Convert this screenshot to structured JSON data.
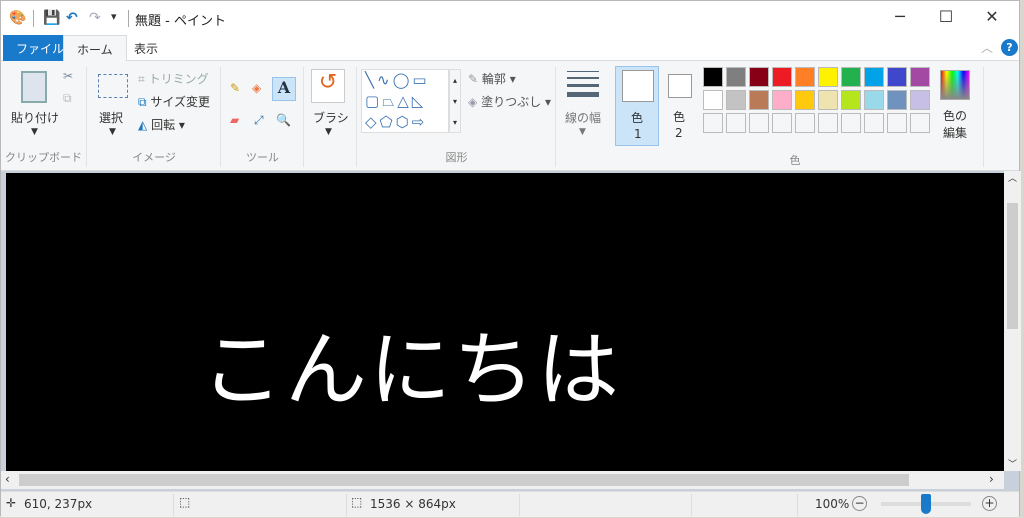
{
  "window": {
    "title": "無題 - ペイント",
    "minimize": "─",
    "maximize": "☐",
    "close": "✕"
  },
  "quick_access": {
    "customize": "▾"
  },
  "tabs": [
    {
      "label": "ファイル"
    },
    {
      "label": "ホーム"
    },
    {
      "label": "表示"
    }
  ],
  "ribbon": {
    "clipboard": {
      "label": "クリップボード",
      "paste": "貼り付け"
    },
    "image": {
      "label": "イメージ",
      "select": "選択",
      "crop": "トリミング",
      "resize": "サイズ変更",
      "rotate": "回転"
    },
    "tools": {
      "label": "ツール"
    },
    "brushes": {
      "label": "ブラシ"
    },
    "shapes": {
      "label": "図形",
      "outline": "輪郭",
      "fill": "塗りつぶし"
    },
    "size": {
      "label": "線の幅"
    },
    "color1": {
      "label": "色",
      "num": "1"
    },
    "color2": {
      "label": "色",
      "num": "2"
    },
    "colors": {
      "label": "色",
      "edit": "色の",
      "edit2": "編集",
      "row1": [
        "#000000",
        "#7f7f7f",
        "#880015",
        "#ed1c24",
        "#ff7f27",
        "#fff200",
        "#22b14c",
        "#00a2e8",
        "#3f48cc",
        "#a349a4"
      ],
      "row2": [
        "#ffffff",
        "#c3c3c3",
        "#b97a57",
        "#ffaec9",
        "#ffc90e",
        "#efe4b0",
        "#b5e61d",
        "#99d9ea",
        "#7092be",
        "#c8bfe7"
      ]
    }
  },
  "canvas": {
    "text": "こんにちは"
  },
  "status": {
    "cursor": "610, 237px",
    "size": "1536 × 864px",
    "zoom": "100%",
    "zoom_level": 100
  }
}
